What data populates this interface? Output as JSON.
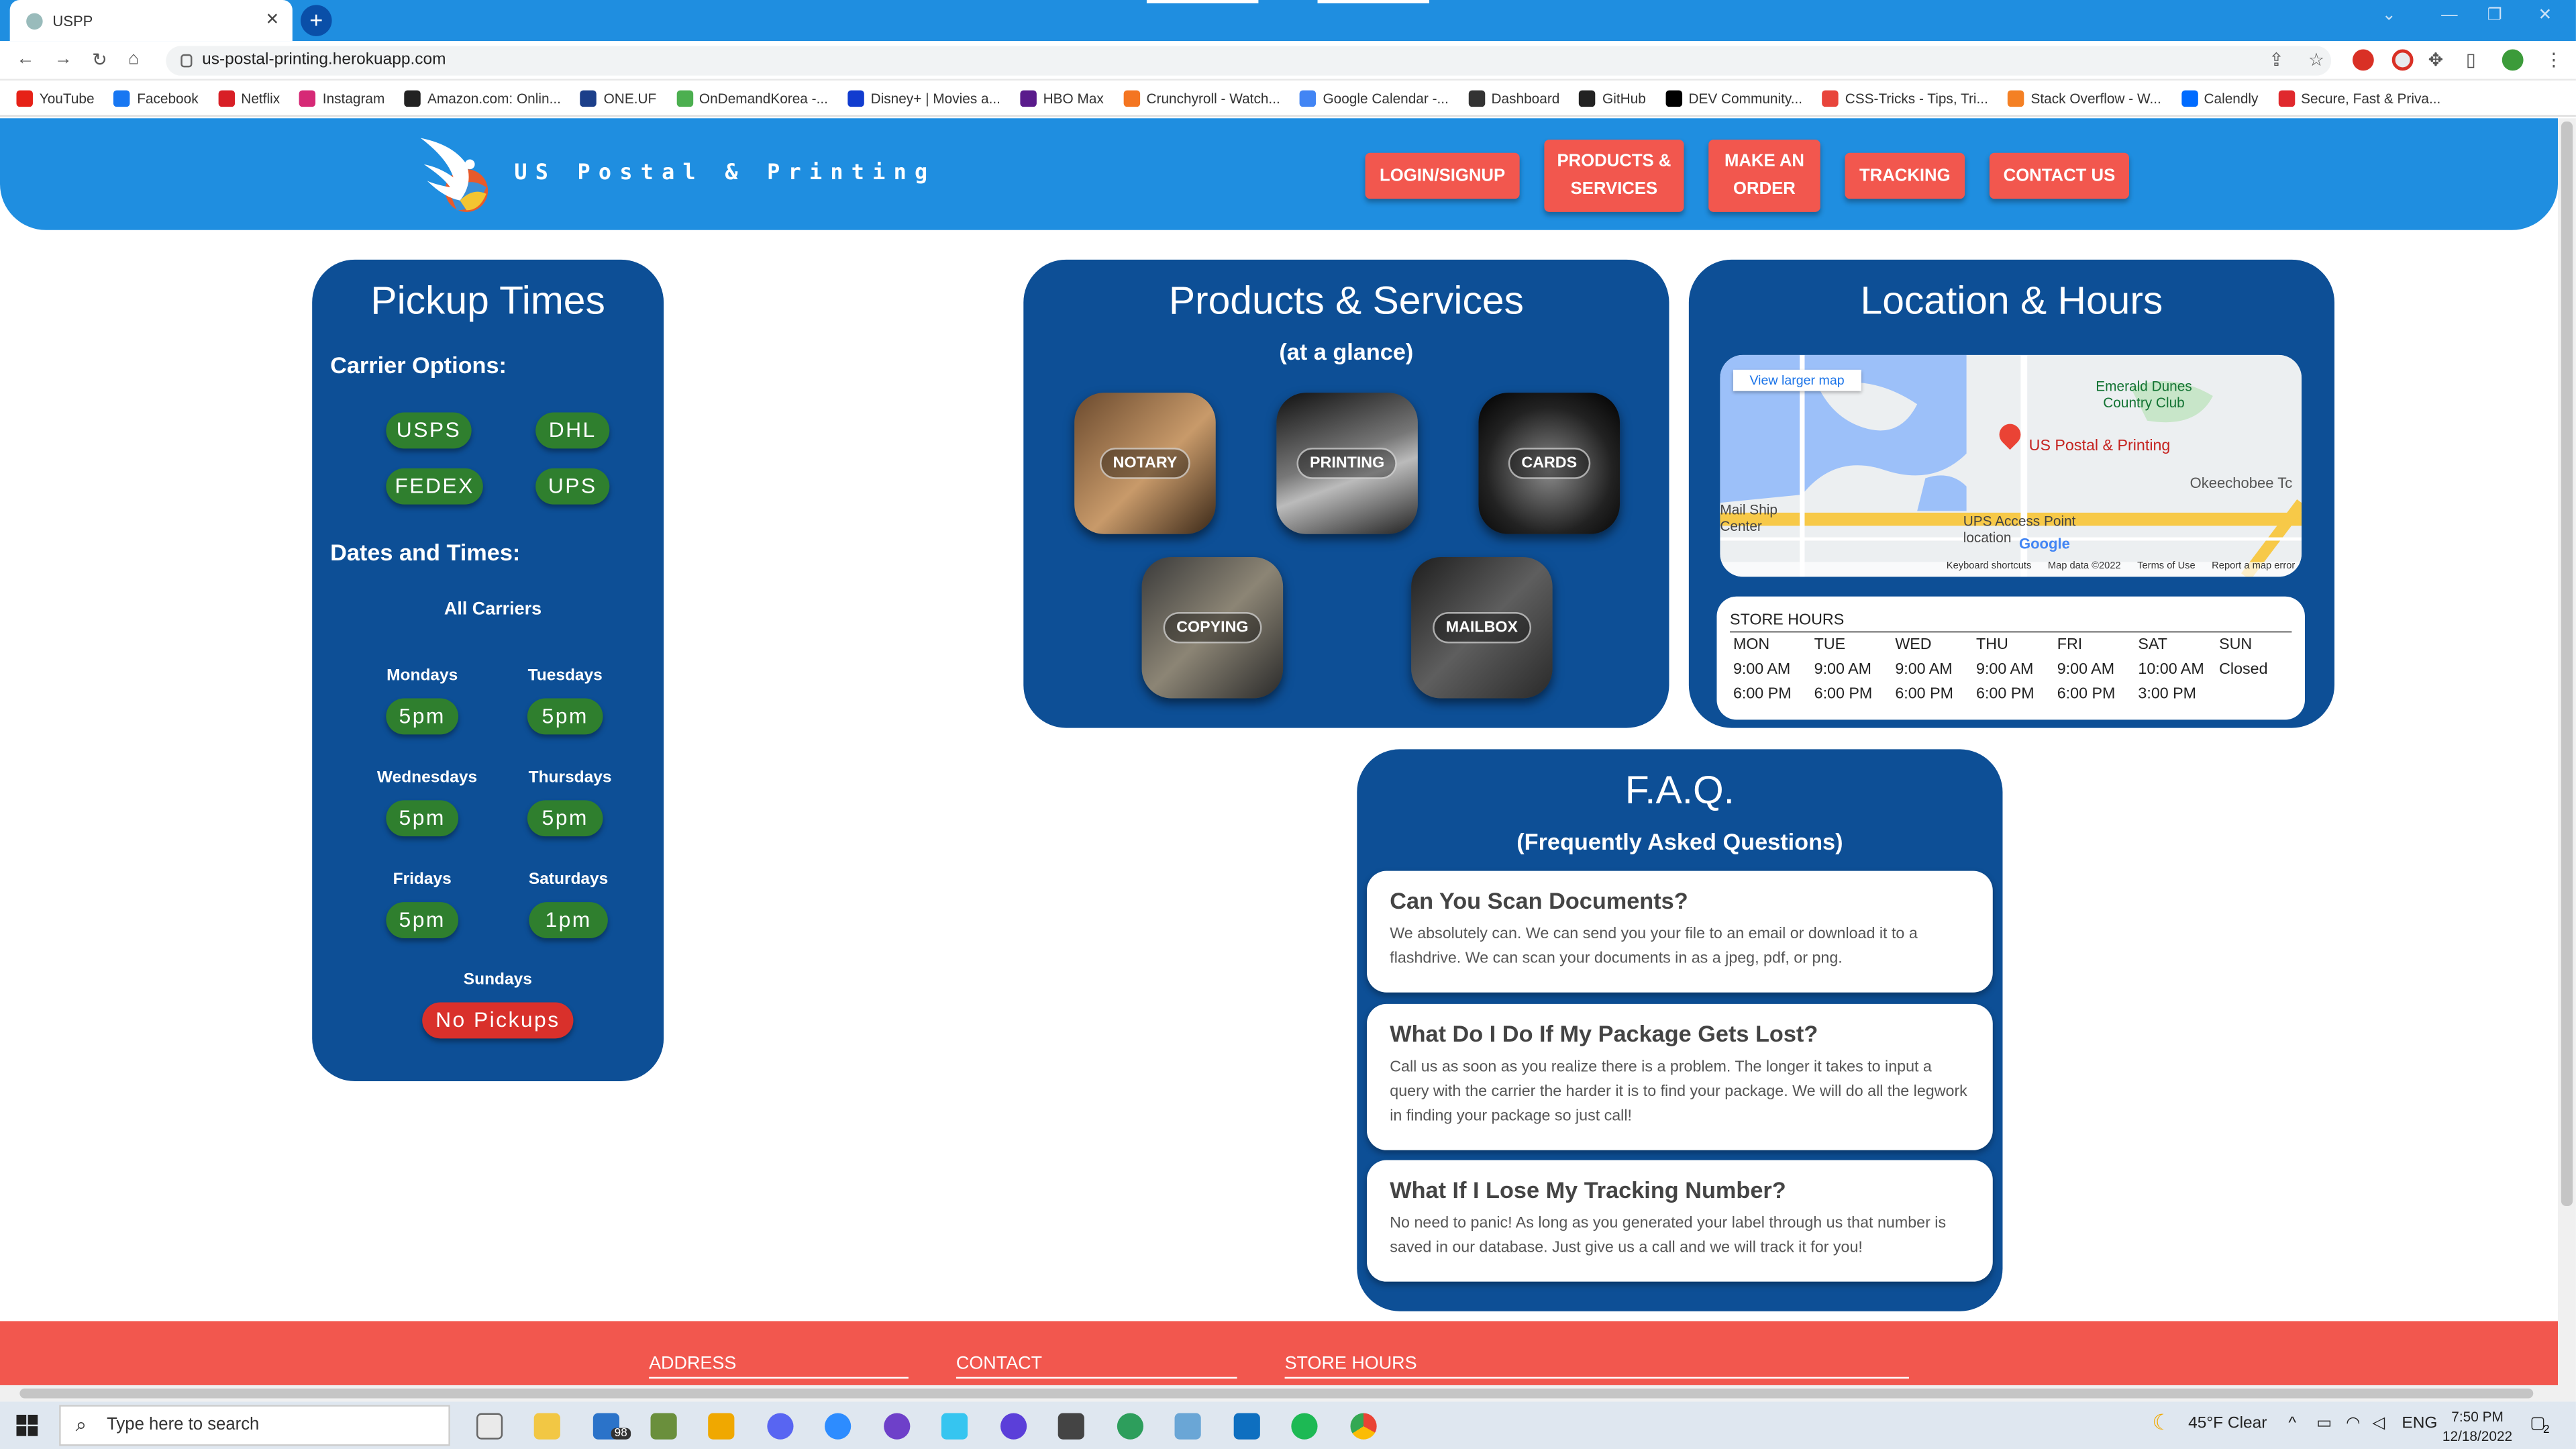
{
  "browser": {
    "tab_title": "USPP",
    "tab_close": "✕",
    "new_tab": "+",
    "url": "us-postal-printing.herokuapp.com",
    "bookmarks": [
      {
        "label": "YouTube",
        "color": "#e62117"
      },
      {
        "label": "Facebook",
        "color": "#1877f2"
      },
      {
        "label": "Netflix",
        "color": "#d81f26"
      },
      {
        "label": "Instagram",
        "color": "#d62976"
      },
      {
        "label": "Amazon.com: Onlin...",
        "color": "#222222"
      },
      {
        "label": "ONE.UF",
        "color": "#1c3f8a"
      },
      {
        "label": "OnDemandKorea -...",
        "color": "#4caf50"
      },
      {
        "label": "Disney+ | Movies a...",
        "color": "#113ccf"
      },
      {
        "label": "HBO Max",
        "color": "#5a1b8c"
      },
      {
        "label": "Crunchyroll - Watch...",
        "color": "#f47521"
      },
      {
        "label": "Google Calendar -...",
        "color": "#4285f4"
      },
      {
        "label": "Dashboard",
        "color": "#333333"
      },
      {
        "label": "GitHub",
        "color": "#222222"
      },
      {
        "label": "DEV Community...",
        "color": "#000000"
      },
      {
        "label": "CSS-Tricks - Tips, Tri...",
        "color": "#e8453c"
      },
      {
        "label": "Stack Overflow - W...",
        "color": "#f48024"
      },
      {
        "label": "Calendly",
        "color": "#006bff"
      },
      {
        "label": "Secure, Fast & Priva...",
        "color": "#e0282d"
      }
    ]
  },
  "site": {
    "brand": "US Postal & Printing",
    "nav": [
      {
        "label": "LOGIN/SIGNUP",
        "name": "login-signup-button"
      },
      {
        "label": "PRODUCTS & SERVICES",
        "name": "products-services-button"
      },
      {
        "label": "MAKE AN ORDER",
        "name": "make-order-button"
      },
      {
        "label": "TRACKING",
        "name": "tracking-button"
      },
      {
        "label": "CONTACT US",
        "name": "contact-us-button"
      }
    ]
  },
  "pickup": {
    "title": "Pickup Times",
    "carrier_heading": "Carrier Options:",
    "carriers": [
      "USPS",
      "DHL",
      "FEDEX",
      "UPS"
    ],
    "dates_heading": "Dates and Times:",
    "all_carriers": "All Carriers",
    "days": [
      {
        "day": "Mondays",
        "time": "5pm"
      },
      {
        "day": "Tuesdays",
        "time": "5pm"
      },
      {
        "day": "Wednesdays",
        "time": "5pm"
      },
      {
        "day": "Thursdays",
        "time": "5pm"
      },
      {
        "day": "Fridays",
        "time": "5pm"
      },
      {
        "day": "Saturdays",
        "time": "1pm"
      }
    ],
    "sunday": {
      "day": "Sundays",
      "time": "No Pickups"
    }
  },
  "products": {
    "title": "Products & Services",
    "subtitle": "(at a glance)",
    "items": [
      "NOTARY",
      "PRINTING",
      "CARDS",
      "COPYING",
      "MAILBOX"
    ]
  },
  "location": {
    "title": "Location & Hours",
    "map": {
      "view_larger": "View larger map",
      "pin_label": "US Postal & Printing",
      "places": [
        "Emerald Dunes Country Club",
        "Okeechobee Tc",
        "Mail Ship Center",
        "UPS Access Point location"
      ],
      "footer": [
        "Keyboard shortcuts",
        "Map data ©2022",
        "Terms of Use",
        "Report a map error"
      ],
      "google": "Google"
    },
    "hours_heading": "STORE HOURS",
    "days": [
      "MON",
      "TUE",
      "WED",
      "THU",
      "FRI",
      "SAT",
      "SUN"
    ],
    "open": [
      "9:00 AM",
      "9:00 AM",
      "9:00 AM",
      "9:00 AM",
      "9:00 AM",
      "10:00 AM",
      "Closed"
    ],
    "close": [
      "6:00 PM",
      "6:00 PM",
      "6:00 PM",
      "6:00 PM",
      "6:00 PM",
      "3:00 PM",
      ""
    ]
  },
  "faq": {
    "title": "F.A.Q.",
    "subtitle": "(Frequently Asked Questions)",
    "items": [
      {
        "q": "Can You Scan Documents?",
        "a": "We absolutely can. We can send you your file to an email or download it to a flashdrive. We can scan your documents in as a jpeg, pdf, or png."
      },
      {
        "q": "What Do I Do If My Package Gets Lost?",
        "a": "Call us as soon as you realize there is a problem. The longer it takes to input a query with the carrier the harder it is to find your package. We will do all the legwork in finding your package so just call!"
      },
      {
        "q": "What If I Lose My Tracking Number?",
        "a": "No need to panic! As long as you generated your label through us that number is saved in our database. Just give us a call and we will track it for you!"
      }
    ]
  },
  "footer": {
    "address": "ADDRESS",
    "contact": "CONTACT",
    "hours": "STORE HOURS"
  },
  "taskbar": {
    "search_placeholder": "Type here to search",
    "mail_badge": "98",
    "weather": "45°F  Clear",
    "lang": "ENG",
    "time": "7:50 PM",
    "date": "12/18/2022",
    "notif": "2"
  },
  "colors": {
    "brand_blue": "#1f8ee0",
    "panel_blue": "#0d4f96",
    "accent_red": "#f2574e",
    "pill_green": "#2f7f2e"
  }
}
